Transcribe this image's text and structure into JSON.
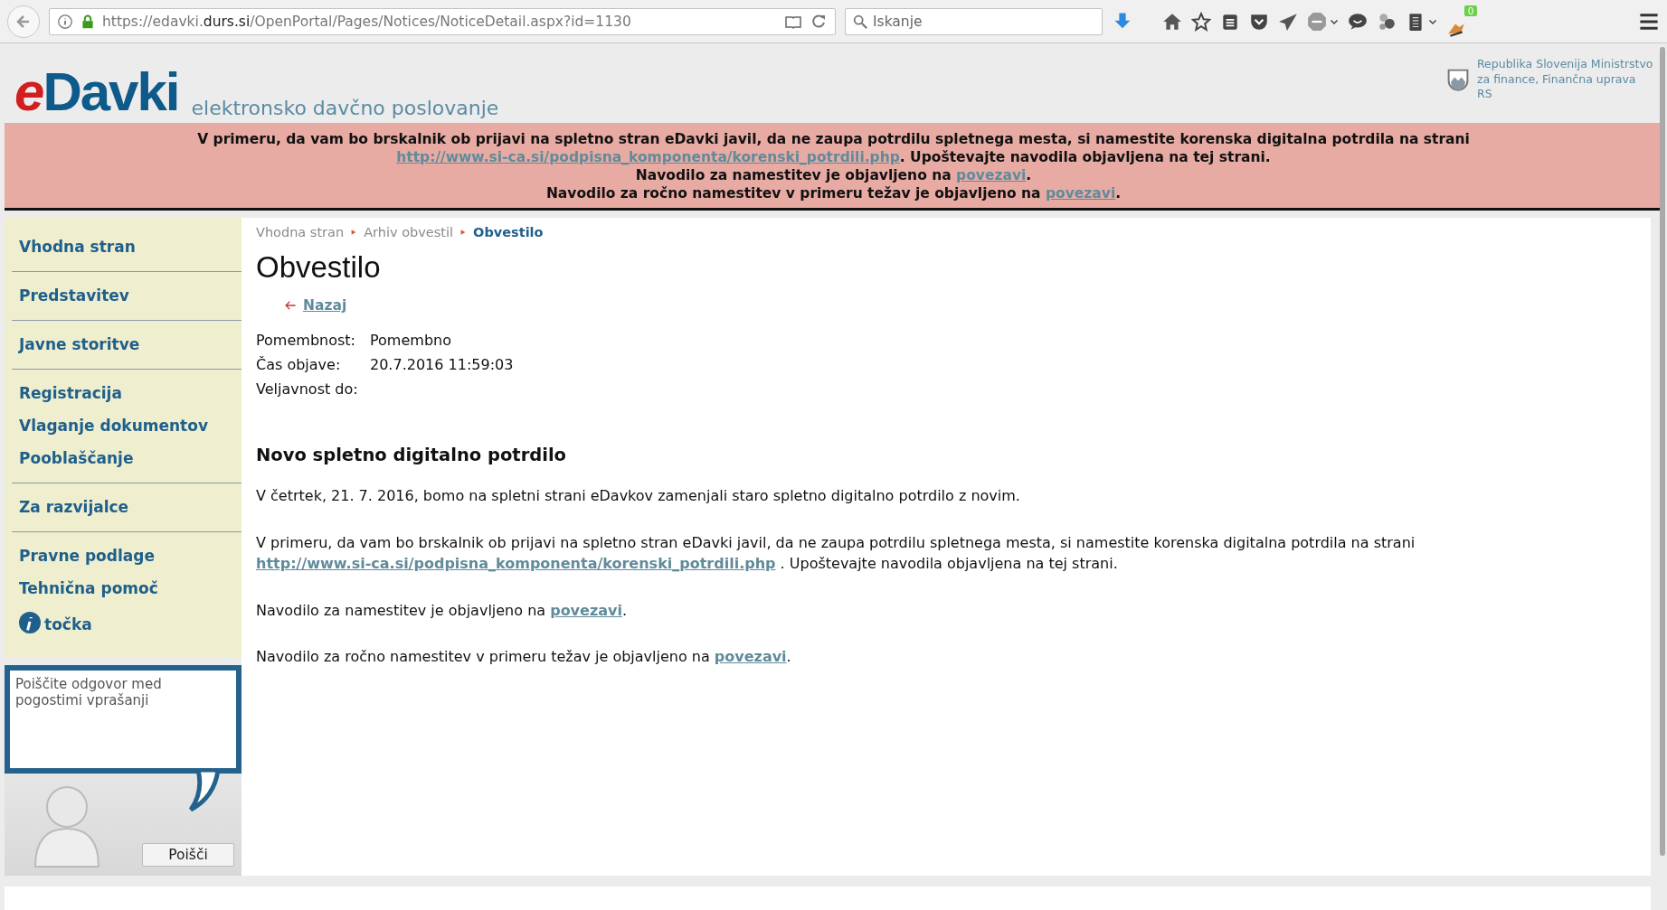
{
  "browser": {
    "url": {
      "prefix": "https://edavki.",
      "domain": "durs.si",
      "path": "/OpenPortal/Pages/Notices/NoticeDetail.aspx?id=1130"
    },
    "search": {
      "placeholder": "Iskanje"
    },
    "badge": "0"
  },
  "header": {
    "logo": {
      "first": "e",
      "rest": "Davki"
    },
    "tagline": "elektronsko davčno poslovanje",
    "ministry": "Republika Slovenija Ministrstvo za finance,  Finančna uprava RS"
  },
  "banner": [
    [
      {
        "kind": "text",
        "text": "V primeru, da vam bo brskalnik ob prijavi na spletno stran eDavki javil, da ne zaupa potrdilu spletnega mesta, si namestite korenska digitalna potrdila na strani "
      },
      {
        "kind": "link",
        "text": "http://www.si-ca.si/podpisna_komponenta/korenski_potrdili.php"
      },
      {
        "kind": "text",
        "text": ". Upoštevajte navodila objavljena na tej strani."
      }
    ],
    [
      {
        "kind": "text",
        "text": "Navodilo za namestitev je objavljeno na "
      },
      {
        "kind": "link",
        "text": "povezavi"
      },
      {
        "kind": "text",
        "text": "."
      }
    ],
    [
      {
        "kind": "text",
        "text": "Navodilo za ročno namestitev v primeru težav je objavljeno na "
      },
      {
        "kind": "link",
        "text": "povezavi"
      },
      {
        "kind": "text",
        "text": "."
      }
    ]
  ],
  "sidebar": {
    "groups": [
      [
        {
          "label": "Vhodna stran",
          "kind": "plain"
        }
      ],
      [
        {
          "label": "Predstavitev",
          "kind": "plain"
        }
      ],
      [
        {
          "label": "Javne storitve",
          "kind": "plain"
        }
      ],
      [
        {
          "label": "Registracija",
          "kind": "plain"
        },
        {
          "label": "Vlaganje dokumentov",
          "kind": "plain"
        },
        {
          "label": "Pooblaščanje",
          "kind": "plain"
        }
      ],
      [
        {
          "label": "Za razvijalce",
          "kind": "plain"
        }
      ],
      [
        {
          "label": "Pravne podlage",
          "kind": "plain"
        },
        {
          "label": "Tehnična pomoč",
          "kind": "plain"
        },
        {
          "label": "točka",
          "kind": "info"
        }
      ]
    ],
    "faq": {
      "placeholder": "Poiščite odgovor med pogostimi vprašanji",
      "button": "Poišči"
    }
  },
  "breadcrumb": [
    {
      "label": "Vhodna stran",
      "selected": false
    },
    {
      "label": "Arhiv obvestil",
      "selected": false
    },
    {
      "label": "Obvestilo",
      "selected": true
    }
  ],
  "title": "Obvestilo",
  "back": "Nazaj",
  "meta": [
    {
      "label": "Pomembnost:",
      "value": "Pomembno"
    },
    {
      "label": "Čas objave:",
      "value": "20.7.2016 11:59:03"
    },
    {
      "label": "Veljavnost do:"
    }
  ],
  "notice": {
    "heading": "Novo spletno digitalno potrdilo",
    "paragraphs": [
      [
        {
          "kind": "text",
          "text": "V četrtek, 21. 7. 2016, bomo na spletni strani eDavkov zamenjali staro spletno digitalno potrdilo z novim."
        }
      ],
      [
        {
          "kind": "text",
          "text": "V primeru, da vam bo brskalnik ob prijavi na spletno stran eDavki javil, da ne zaupa potrdilu spletnega mesta, si namestite korenska digitalna potrdila na strani "
        },
        {
          "kind": "link",
          "text": "http://www.si-ca.si/podpisna_komponenta/korenski_potrdili.php"
        },
        {
          "kind": "text",
          "text": " . Upoštevajte navodila objavljena na tej strani."
        }
      ],
      [
        {
          "kind": "text",
          "text": "Navodilo za namestitev je objavljeno na "
        },
        {
          "kind": "link",
          "text": "povezavi"
        },
        {
          "kind": "text",
          "text": "."
        }
      ],
      [
        {
          "kind": "text",
          "text": "Navodilo za ročno namestitev v primeru težav je objavljeno na "
        },
        {
          "kind": "link",
          "text": "povezavi"
        },
        {
          "kind": "text",
          "text": "."
        }
      ]
    ]
  }
}
